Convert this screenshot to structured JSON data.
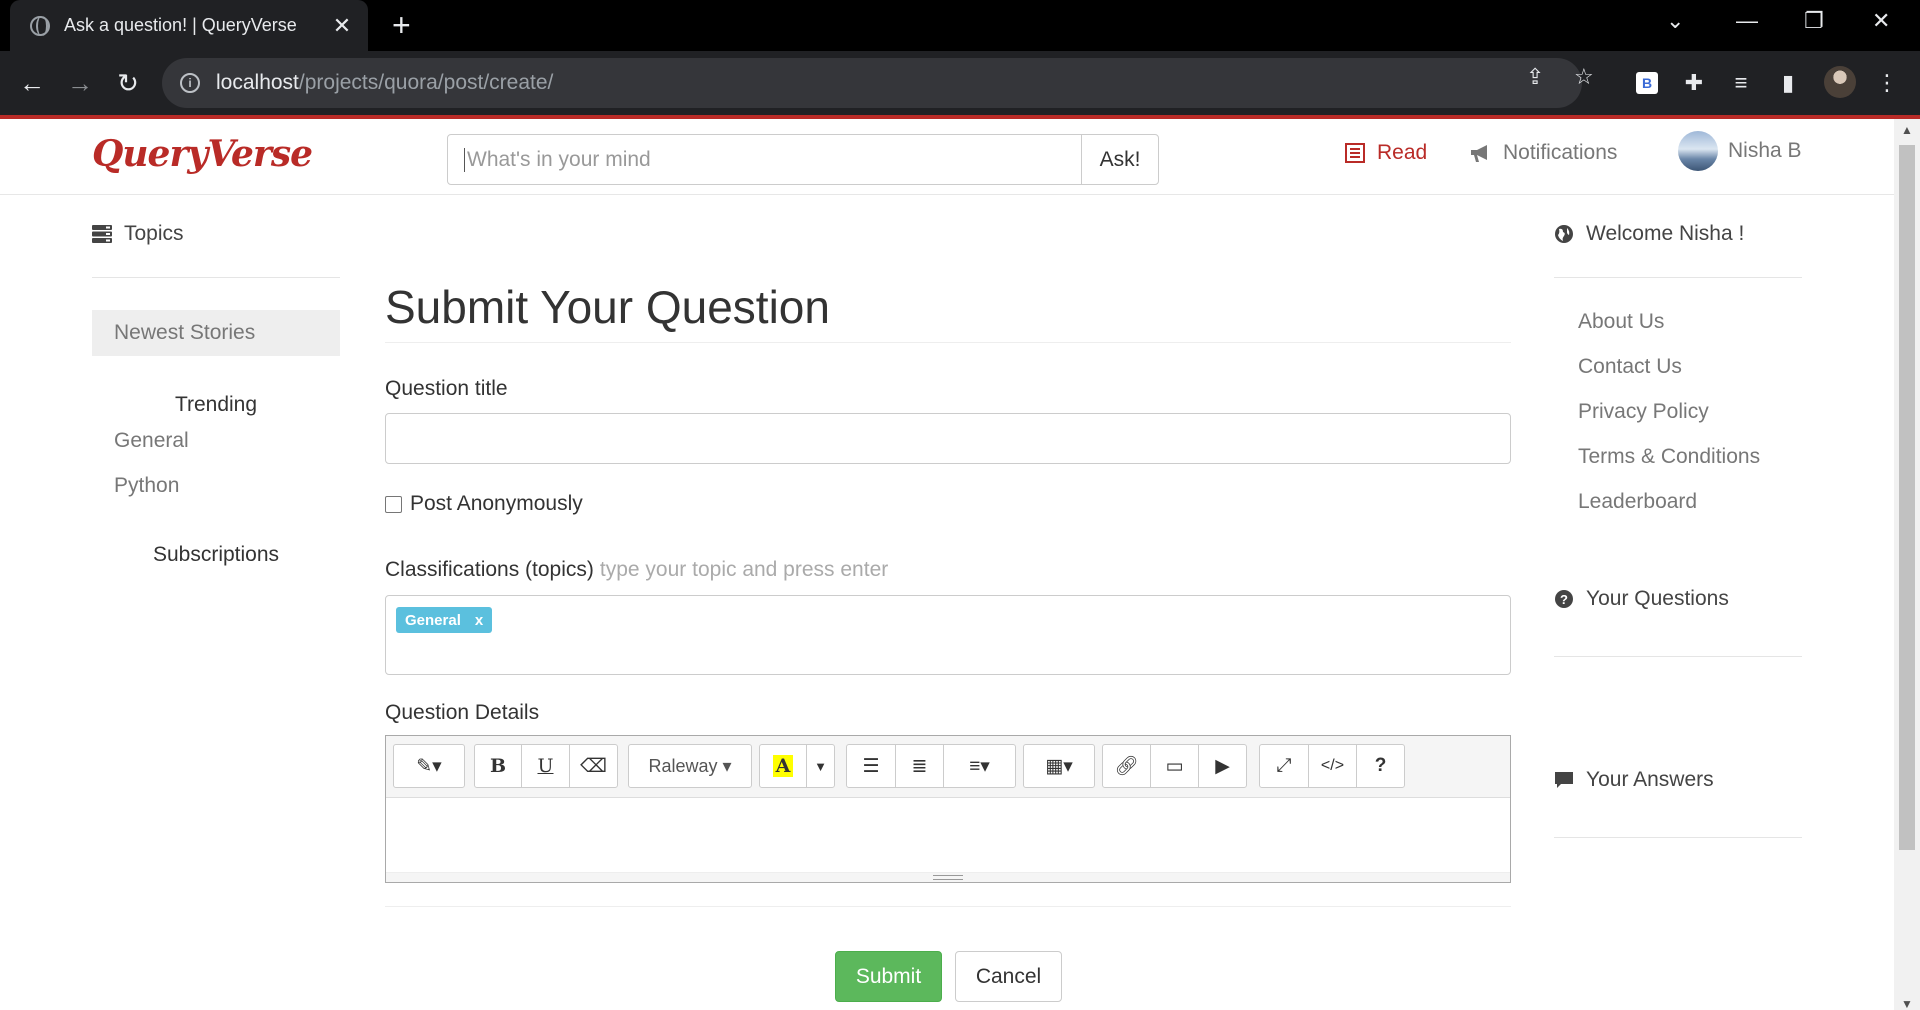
{
  "browser": {
    "tab_title": "Ask a question! | QueryVerse",
    "url_host": "localhost",
    "url_path": "/projects/quora/post/create/"
  },
  "navbar": {
    "brand": "QueryVerse",
    "search_placeholder": "What's in your mind",
    "ask_label": "Ask!",
    "read_label": "Read",
    "notifications_label": "Notifications",
    "user_name": "Nisha B"
  },
  "left_sidebar": {
    "topics_label": "Topics",
    "newest_label": "Newest Stories",
    "trending_label": "Trending",
    "trending_items": [
      "General",
      "Python"
    ],
    "subscriptions_label": "Subscriptions"
  },
  "main": {
    "heading": "Submit Your Question",
    "title_label": "Question title",
    "title_value": "",
    "anon_label": "Post Anonymously",
    "anon_checked": false,
    "topics_label": "Classifications (topics)",
    "topics_hint": "type your topic and press enter",
    "tags": [
      {
        "label": "General",
        "remove": "x"
      }
    ],
    "details_label": "Question Details",
    "font_label": "Raleway",
    "submit_label": "Submit",
    "cancel_label": "Cancel"
  },
  "right_sidebar": {
    "welcome": "Welcome Nisha !",
    "links": [
      "About Us",
      "Contact Us",
      "Privacy Policy",
      "Terms & Conditions",
      "Leaderboard"
    ],
    "your_questions": "Your Questions",
    "your_answers": "Your Answers"
  },
  "colors": {
    "brand": "#b92b27",
    "submit": "#5cb85c",
    "tag": "#5bc0de"
  }
}
